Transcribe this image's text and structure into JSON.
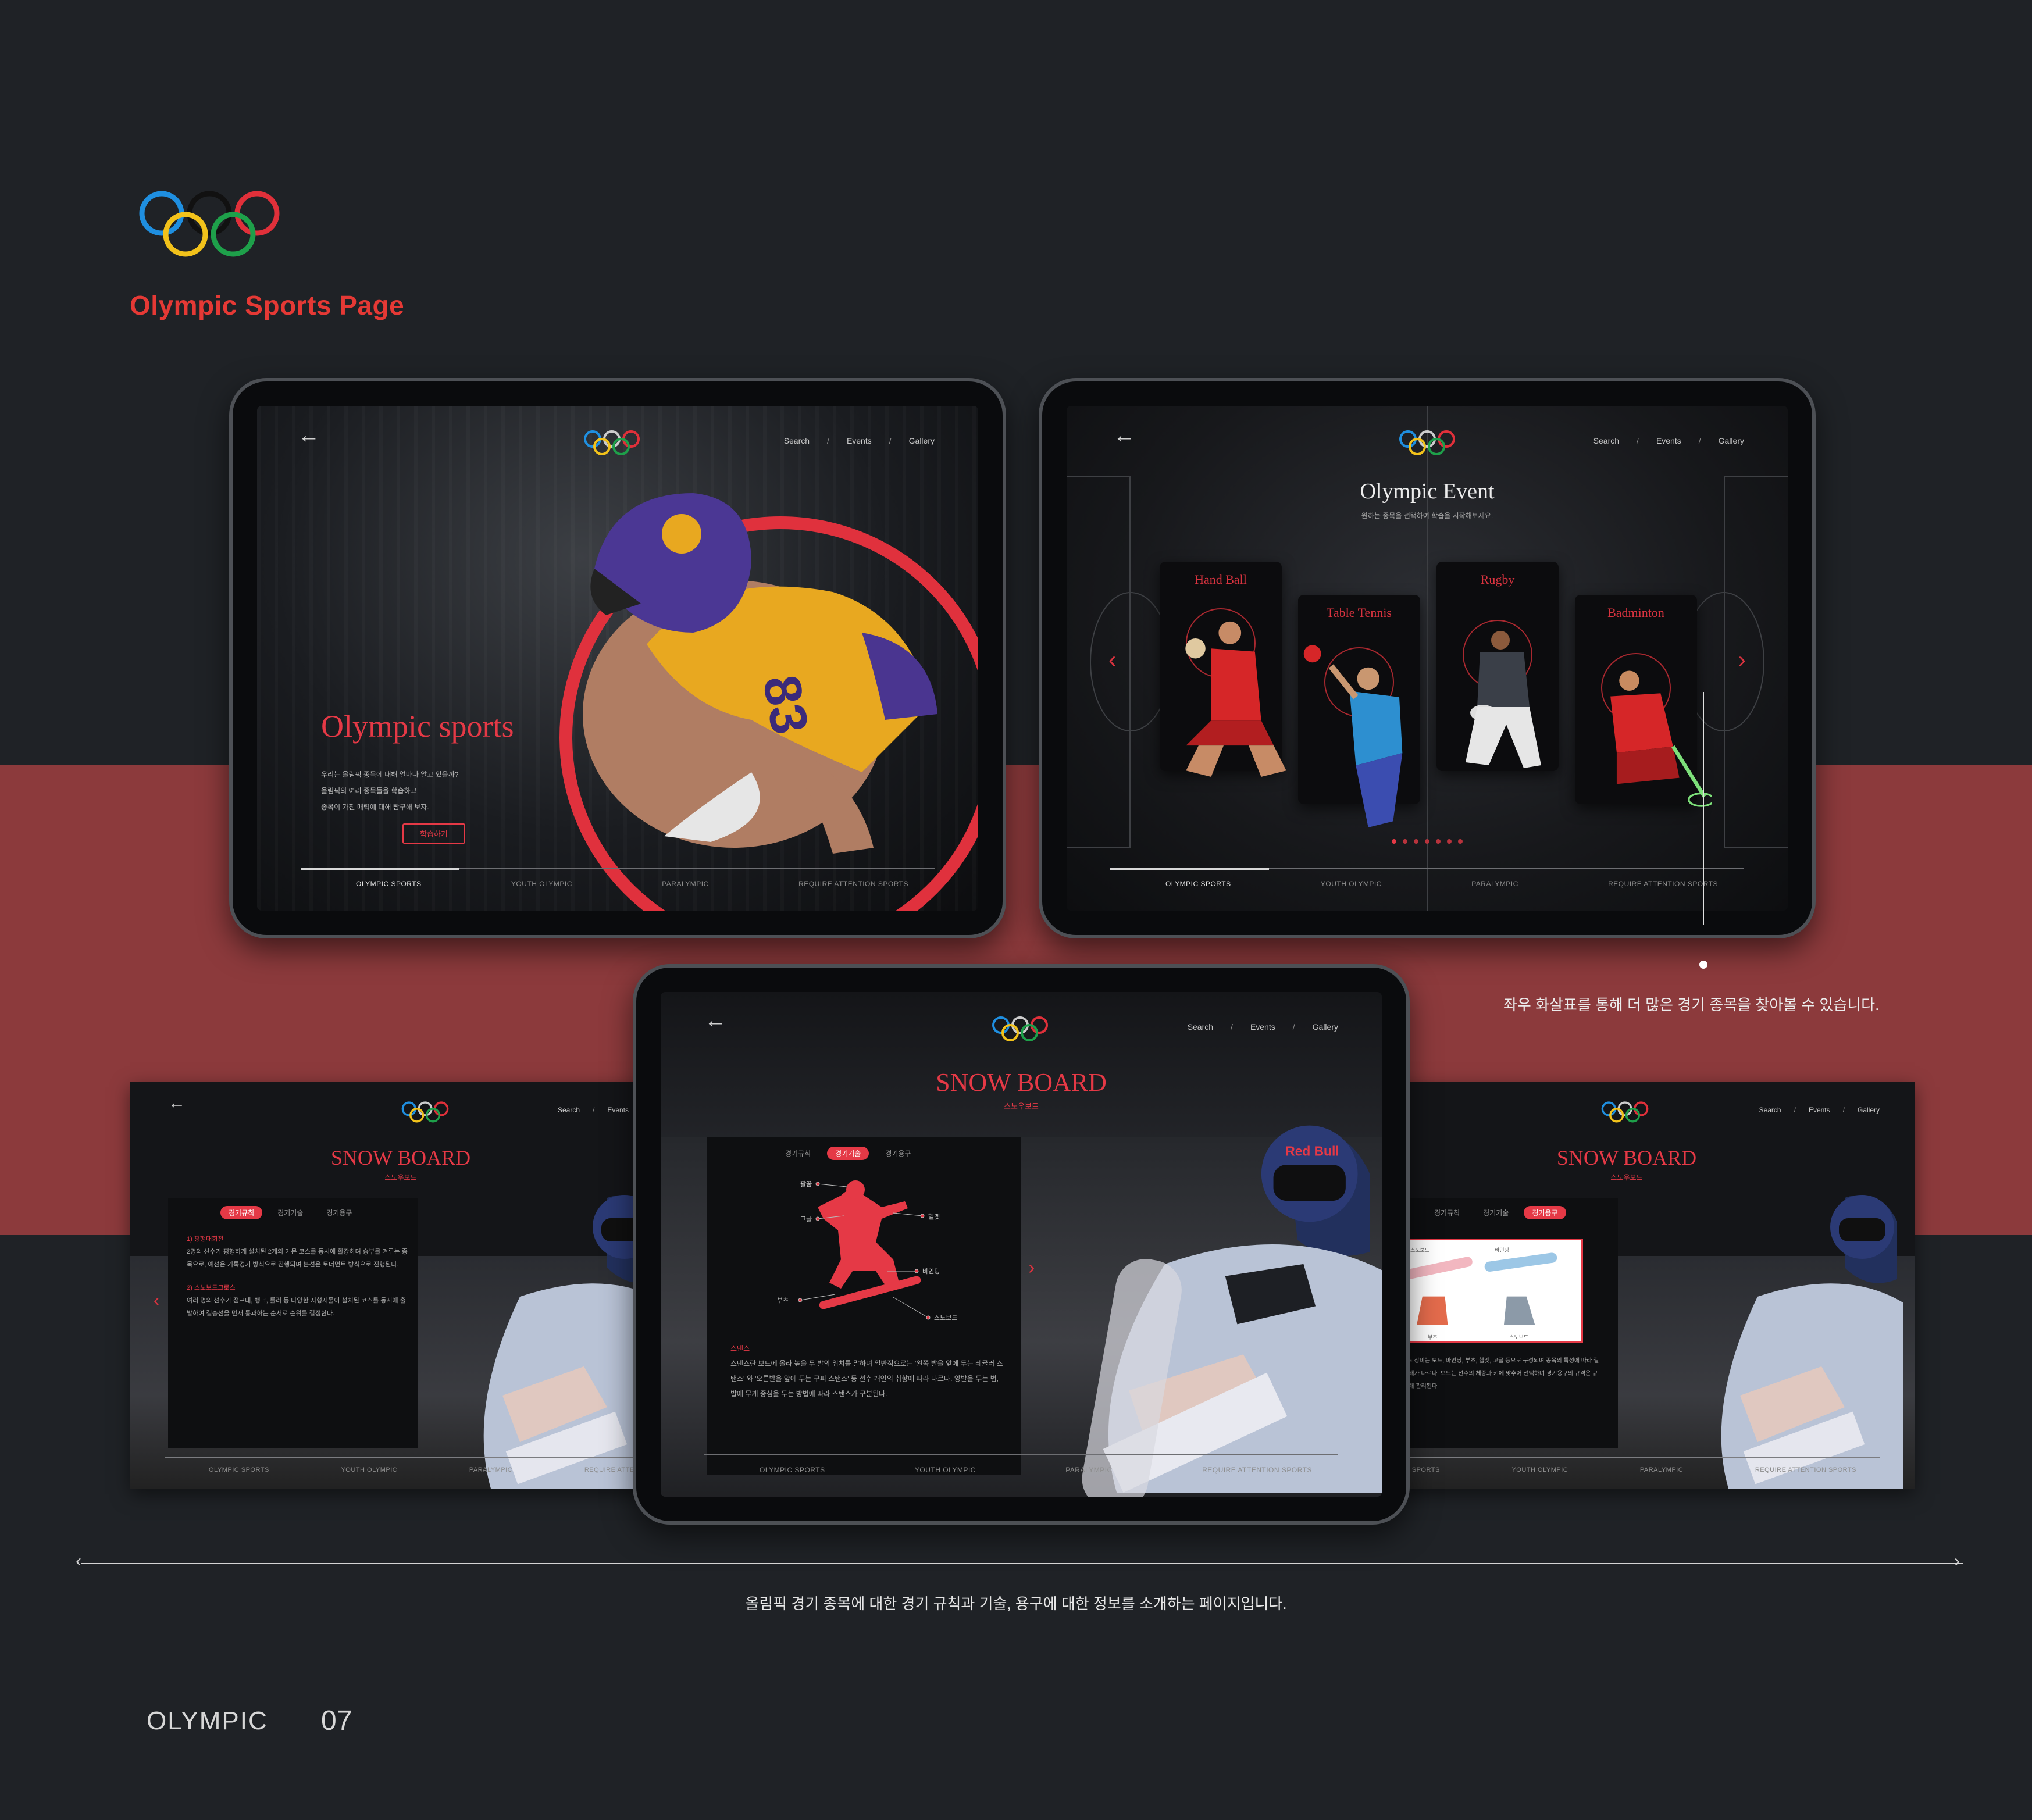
{
  "header": {
    "title": "Olympic Sports Page",
    "colors": {
      "accent": "#e53935",
      "band": "#8c3a3c",
      "background": "#1f2226"
    }
  },
  "nav": {
    "back_icon": "arrow-left-icon",
    "links": [
      "Search",
      "Events",
      "Gallery"
    ]
  },
  "tabs": [
    "OLYMPIC SPORTS",
    "YOUTH OLYMPIC",
    "PARALYMPIC",
    "REQUIRE ATTENTION SPORTS"
  ],
  "tablet1": {
    "hero_title": "Olympic sports",
    "hero_lines": [
      "우리는 올림픽 종목에 대해 얼마나 알고 있을까?",
      "올림픽의 여러 종목들을 학습하고",
      "종목이 가진 매력에 대해 탐구해 보자."
    ],
    "button": "학습하기",
    "tab_progress": 0.25
  },
  "tablet2": {
    "title": "Olympic Event",
    "subtitle": "원하는 종목을 선택하여 학습을 시작해보세요.",
    "cards": [
      "Hand Ball",
      "Table Tennis",
      "Rugby",
      "Badminton"
    ],
    "pagination_count": 7,
    "pagination_active": 0,
    "tab_progress": 0.25
  },
  "snowboard": {
    "title": "SNOW BOARD",
    "subtitle": "스노우보드",
    "subtabs": [
      "경기규칙",
      "경기기술",
      "경기용구"
    ]
  },
  "left_panel": {
    "active_tab": 0,
    "sections": [
      {
        "heading": "1) 평행대회전",
        "body": "2명의 선수가 평행하게 설치된 2개의 기문 코스를 동시에 활강하며 승부를 겨루는 종목으로, 예선은 기록경기 방식으로 진행되며 본선은 토너먼트 방식으로 진행된다."
      },
      {
        "heading": "2) 스노보드크로스",
        "body": "여러 명의 선수가 점프대, 뱅크, 롤러 등 다양한 지형지물이 설치된 코스를 동시에 출발하여 결승선을 먼저 통과하는 순서로 순위를 결정한다."
      }
    ]
  },
  "center_panel": {
    "active_tab": 1,
    "labels": [
      "팔꿈",
      "고글",
      "헬멧",
      "팔꿈",
      "바인딩",
      "부츠",
      "스노보드"
    ],
    "heading": "스탠스",
    "body": "스탠스란 보드에 올라 높을 두 발의 위치를 말하며 일반적으로는 '왼쪽 발을 앞에 두는 레귤러 스탠스' 와 '오른발을 앞에 두는 구피 스탠스' 등 선수 개인의 취향에 따라 다르다. 양발을 두는 법, 발에 무게 중심을 두는 방법에 따라 스탠스가 구분된다."
  },
  "right_panel": {
    "active_tab": 2,
    "image_labels": [
      "스노보드",
      "바인딩",
      "부츠",
      "스노보드"
    ],
    "body": "스노보드 장비는 보드, 바인딩, 부츠, 헬멧, 고글 등으로 구성되며 종목의 특성에 따라 길이와 형태가 다르다. 보드는 선수의 체중과 키에 맞추어 선택하며 경기용구의 규격은 규정에 의해 관리된다."
  },
  "annotations": {
    "arrows_note": "좌우 화살표를 통해 더 많은 경기 종목을 찾아볼 수 있습니다.",
    "bottom_caption": "올림픽 경기 종목에 대한 경기 규칙과 기술, 용구에 대한 정보를 소개하는 페이지입니다."
  },
  "footer": {
    "label": "OLYMPIC",
    "page": "07"
  }
}
